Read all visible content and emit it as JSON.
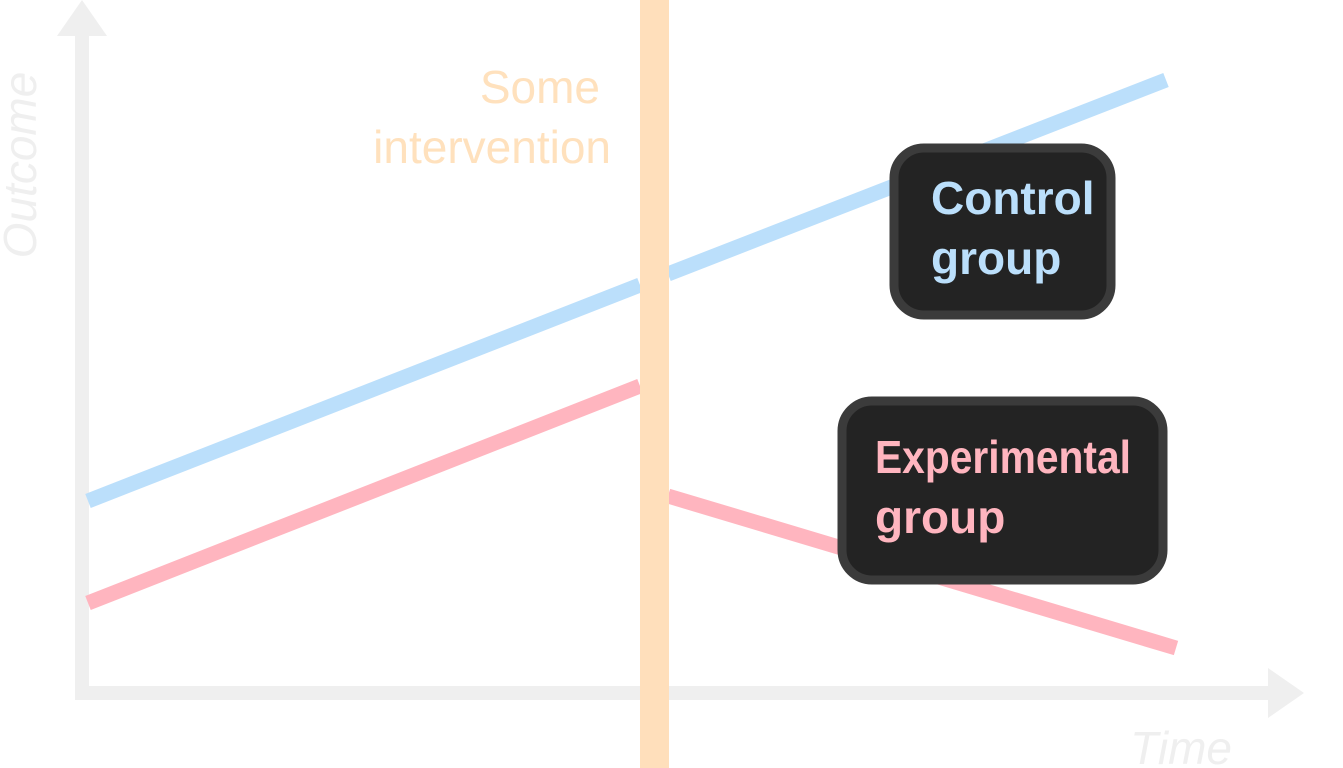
{
  "diagram": {
    "axes": {
      "y_title": "Outcome",
      "x_title": "Time",
      "color": "#efefef"
    },
    "intervention": {
      "label_lines": [
        "Some",
        "intervention"
      ],
      "color": "#ffdfbb",
      "text_color": "#ffe1bd"
    },
    "groups": [
      {
        "id": "control",
        "label_lines": [
          "Control",
          "group"
        ],
        "color": "#bbdffb",
        "trend_after_intervention": "continues rising"
      },
      {
        "id": "experimental",
        "label_lines": [
          "Experimental",
          "group"
        ],
        "color": "#ffb5bf",
        "trend_after_intervention": "drops and falls"
      }
    ],
    "callout_background": "#232323"
  }
}
